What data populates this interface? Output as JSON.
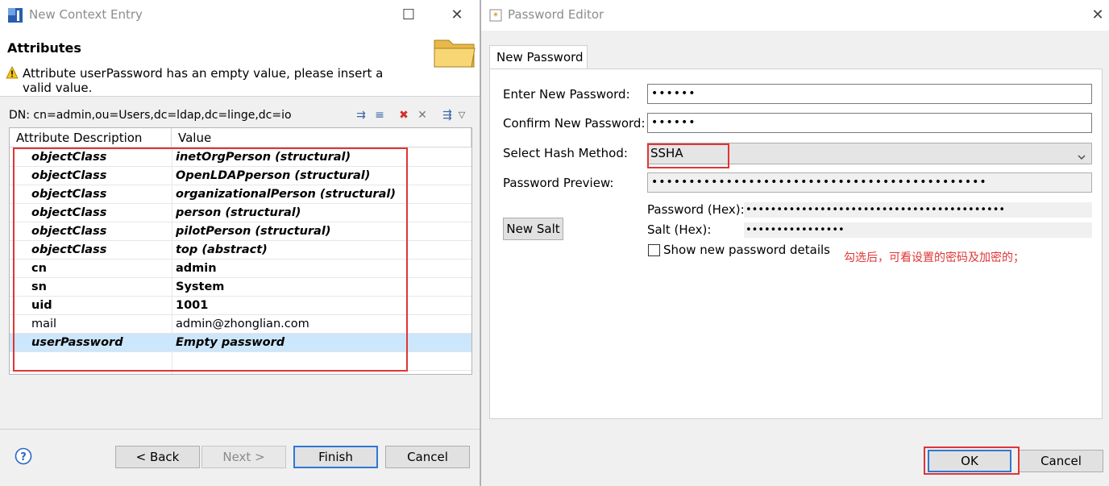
{
  "left_window": {
    "title": "New Context Entry",
    "minimize_glyph": "☐",
    "close_glyph": "✕",
    "section_title": "Attributes",
    "warning": "Attribute userPassword has an empty value, please insert a valid value.",
    "dn": "DN: cn=admin,ou=Users,dc=ldap,dc=linge,dc=io",
    "columns": [
      "Attribute Description",
      "Value"
    ],
    "rows": [
      {
        "attr": "objectClass",
        "value": "inetOrgPerson (structural)"
      },
      {
        "attr": "objectClass",
        "value": "OpenLDAPperson (structural)"
      },
      {
        "attr": "objectClass",
        "value": "organizationalPerson (structural)"
      },
      {
        "attr": "objectClass",
        "value": "person (structural)"
      },
      {
        "attr": "objectClass",
        "value": "pilotPerson (structural)"
      },
      {
        "attr": "objectClass",
        "value": "top (abstract)"
      },
      {
        "attr": "cn",
        "value": "admin"
      },
      {
        "attr": "sn",
        "value": "System"
      },
      {
        "attr": "uid",
        "value": "1001"
      },
      {
        "attr": "mail",
        "value": "admin@zhonglian.com"
      },
      {
        "attr": "userPassword",
        "value": "Empty password"
      }
    ],
    "help_glyph": "?",
    "buttons": {
      "back": "< Back",
      "next": "Next >",
      "finish": "Finish",
      "cancel": "Cancel"
    }
  },
  "right_window": {
    "title": "Password Editor",
    "close_glyph": "✕",
    "tab": "New Password",
    "enter_label": "Enter New Password:",
    "enter_value": "••••••",
    "confirm_label": "Confirm New Password:",
    "confirm_value": "••••••",
    "hash_label": "Select Hash Method:",
    "hash_value": "SSHA",
    "preview_label": "Password Preview:",
    "preview_value": "•••••••••••••••••••••••••••••••••••••••••••••",
    "password_hex_label": "Password (Hex):",
    "password_hex_value": "••••••••••••••••••••••••••••••••••••••••••",
    "salt_hex_label": "Salt (Hex):",
    "salt_hex_value": "••••••••••••••••",
    "new_salt": "New Salt",
    "show_details": "Show new password details",
    "annotation": "勾选后，可看设置的密码及加密的；",
    "buttons": {
      "ok": "OK",
      "cancel": "Cancel"
    }
  },
  "colors": {
    "annotation_red": "#e03535",
    "selection": "#cce6fb",
    "default_button": "#2f78d4"
  }
}
